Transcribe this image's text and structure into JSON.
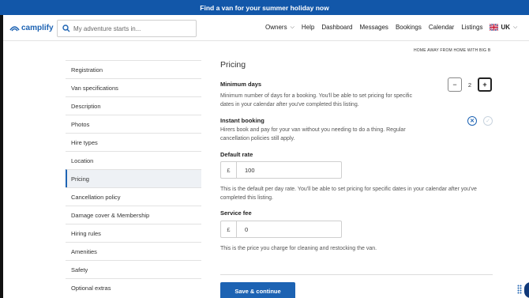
{
  "banner": {
    "text": "Find a van for your summer holiday now"
  },
  "header": {
    "logo_text": "camplify",
    "search_placeholder": "My adventure starts in...",
    "nav": [
      {
        "label": "Owners",
        "has_dropdown": true
      },
      {
        "label": "Help"
      },
      {
        "label": "Dashboard"
      },
      {
        "label": "Messages"
      },
      {
        "label": "Bookings"
      },
      {
        "label": "Calendar"
      },
      {
        "label": "Listings"
      }
    ],
    "region": "UK"
  },
  "breadcrumb": "HOME AWAY FROM HOME WITH BIG B",
  "sidebar": {
    "items": [
      {
        "label": "Registration"
      },
      {
        "label": "Van specifications"
      },
      {
        "label": "Description"
      },
      {
        "label": "Photos"
      },
      {
        "label": "Hire types"
      },
      {
        "label": "Location"
      },
      {
        "label": "Pricing",
        "active": true
      },
      {
        "label": "Cancellation policy"
      },
      {
        "label": "Damage cover & Membership"
      },
      {
        "label": "Hiring rules"
      },
      {
        "label": "Amenities"
      },
      {
        "label": "Safety"
      },
      {
        "label": "Optional extras"
      }
    ]
  },
  "pricing": {
    "title": "Pricing",
    "min_days": {
      "label": "Minimum days",
      "desc": "Minimum number of days for a booking. You'll be able to set pricing for specific dates in your calendar after you've completed this listing.",
      "value": "2",
      "minus": "−",
      "plus": "+"
    },
    "instant_booking": {
      "label": "Instant booking",
      "desc": "Hirers book and pay for your van without you needing to do a thing. Regular cancellation policies still apply.",
      "selected": "no"
    },
    "default_rate": {
      "label": "Default rate",
      "prefix": "£",
      "value": "100",
      "desc": "This is the default per day rate. You'll be able to set pricing for specific dates in your calendar after you've completed this listing."
    },
    "service_fee": {
      "label": "Service fee",
      "prefix": "£",
      "value": "0",
      "desc": "This is the price you charge for cleaning and restocking the van."
    },
    "save_label": "Save & continue"
  },
  "colors": {
    "brand": "#1d63b3",
    "banner": "#1257a9"
  }
}
